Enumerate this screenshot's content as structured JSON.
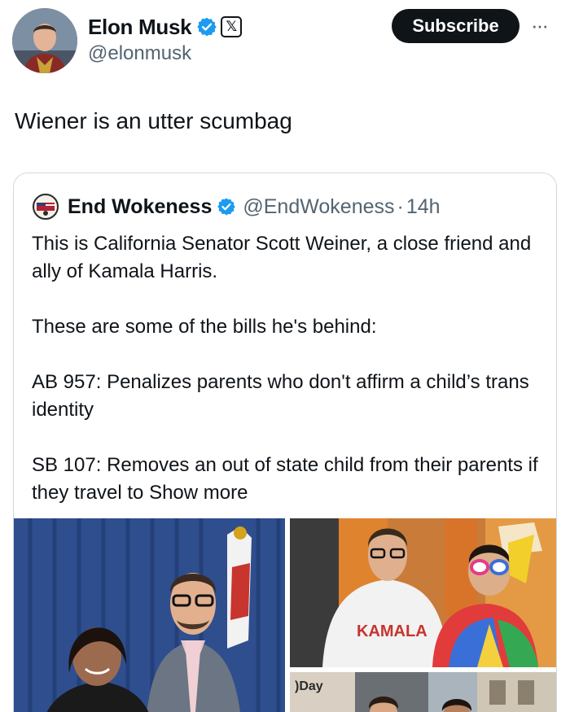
{
  "author": {
    "name": "Elon Musk",
    "handle": "@elonmusk",
    "verified_icon": "verified-badge-icon",
    "affiliate_icon": "x-logo-icon",
    "affiliate_glyph": "𝕏"
  },
  "actions": {
    "subscribe_label": "Subscribe",
    "more_label": "···"
  },
  "tweet": {
    "text": "Wiener is an utter scumbag"
  },
  "quoted": {
    "name": "End Wokeness",
    "handle": "@EndWokeness",
    "separator": "·",
    "time": "14h",
    "paragraphs": [
      "This is California Senator Scott Weiner, a close friend and ally of Kamala Harris.",
      "These are some of the bills he's behind:",
      "AB 957: Penalizes parents who don't affirm a child’s trans identity",
      "SB 107: Removes an out of state child from their parents if they travel to"
    ],
    "show_more": "Show more",
    "media": {
      "shirt_text": "KAMALA"
    }
  },
  "colors": {
    "text": "#0f1419",
    "secondary": "#536471",
    "verified_blue": "#1d9bf0",
    "border": "#cfd9de"
  }
}
